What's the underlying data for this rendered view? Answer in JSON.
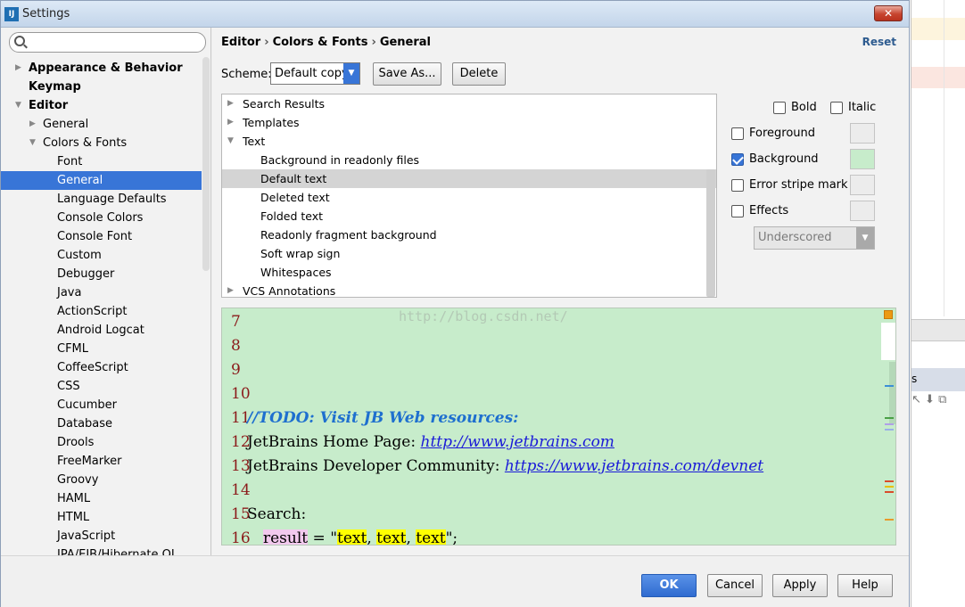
{
  "window": {
    "title": "Settings",
    "close_label": "✕"
  },
  "search": {
    "placeholder": "",
    "value": ""
  },
  "tree": [
    {
      "label": "Appearance & Behavior",
      "level": 0,
      "arrow": "▶",
      "bold": true,
      "selected": false
    },
    {
      "label": "Keymap",
      "level": 0,
      "arrow": "",
      "bold": true,
      "selected": false
    },
    {
      "label": "Editor",
      "level": 0,
      "arrow": "▼",
      "bold": true,
      "selected": false
    },
    {
      "label": "General",
      "level": 1,
      "arrow": "▶",
      "bold": false,
      "selected": false
    },
    {
      "label": "Colors & Fonts",
      "level": 1,
      "arrow": "▼",
      "bold": false,
      "selected": false
    },
    {
      "label": "Font",
      "level": 2,
      "arrow": "",
      "bold": false,
      "selected": false
    },
    {
      "label": "General",
      "level": 2,
      "arrow": "",
      "bold": false,
      "selected": true
    },
    {
      "label": "Language Defaults",
      "level": 2,
      "arrow": "",
      "bold": false,
      "selected": false
    },
    {
      "label": "Console Colors",
      "level": 2,
      "arrow": "",
      "bold": false,
      "selected": false
    },
    {
      "label": "Console Font",
      "level": 2,
      "arrow": "",
      "bold": false,
      "selected": false
    },
    {
      "label": "Custom",
      "level": 2,
      "arrow": "",
      "bold": false,
      "selected": false
    },
    {
      "label": "Debugger",
      "level": 2,
      "arrow": "",
      "bold": false,
      "selected": false
    },
    {
      "label": "Java",
      "level": 2,
      "arrow": "",
      "bold": false,
      "selected": false
    },
    {
      "label": "ActionScript",
      "level": 2,
      "arrow": "",
      "bold": false,
      "selected": false
    },
    {
      "label": "Android Logcat",
      "level": 2,
      "arrow": "",
      "bold": false,
      "selected": false
    },
    {
      "label": "CFML",
      "level": 2,
      "arrow": "",
      "bold": false,
      "selected": false
    },
    {
      "label": "CoffeeScript",
      "level": 2,
      "arrow": "",
      "bold": false,
      "selected": false
    },
    {
      "label": "CSS",
      "level": 2,
      "arrow": "",
      "bold": false,
      "selected": false
    },
    {
      "label": "Cucumber",
      "level": 2,
      "arrow": "",
      "bold": false,
      "selected": false
    },
    {
      "label": "Database",
      "level": 2,
      "arrow": "",
      "bold": false,
      "selected": false
    },
    {
      "label": "Drools",
      "level": 2,
      "arrow": "",
      "bold": false,
      "selected": false
    },
    {
      "label": "FreeMarker",
      "level": 2,
      "arrow": "",
      "bold": false,
      "selected": false
    },
    {
      "label": "Groovy",
      "level": 2,
      "arrow": "",
      "bold": false,
      "selected": false
    },
    {
      "label": "HAML",
      "level": 2,
      "arrow": "",
      "bold": false,
      "selected": false
    },
    {
      "label": "HTML",
      "level": 2,
      "arrow": "",
      "bold": false,
      "selected": false
    },
    {
      "label": "JavaScript",
      "level": 2,
      "arrow": "",
      "bold": false,
      "selected": false
    },
    {
      "label": "JPA/EJB/Hibernate QL",
      "level": 2,
      "arrow": "",
      "bold": false,
      "selected": false
    }
  ],
  "breadcrumb": {
    "part1": "Editor",
    "part2": "Colors & Fonts",
    "part3": "General",
    "sep": "›"
  },
  "reset_label": "Reset",
  "scheme": {
    "label": "Scheme:",
    "value": "Default copy",
    "save_as_label": "Save As...",
    "delete_label": "Delete"
  },
  "elements": [
    {
      "label": "Search Results",
      "arrow": "▶",
      "level": 0,
      "selected": false
    },
    {
      "label": "Templates",
      "arrow": "▶",
      "level": 0,
      "selected": false
    },
    {
      "label": "Text",
      "arrow": "▼",
      "level": 0,
      "selected": false
    },
    {
      "label": "Background in readonly files",
      "arrow": "",
      "level": 1,
      "selected": false
    },
    {
      "label": "Default text",
      "arrow": "",
      "level": 1,
      "selected": true
    },
    {
      "label": "Deleted text",
      "arrow": "",
      "level": 1,
      "selected": false
    },
    {
      "label": "Folded text",
      "arrow": "",
      "level": 1,
      "selected": false
    },
    {
      "label": "Readonly fragment background",
      "arrow": "",
      "level": 1,
      "selected": false
    },
    {
      "label": "Soft wrap sign",
      "arrow": "",
      "level": 1,
      "selected": false
    },
    {
      "label": "Whitespaces",
      "arrow": "",
      "level": 1,
      "selected": false
    },
    {
      "label": "VCS Annotations",
      "arrow": "▶",
      "level": 0,
      "selected": false
    }
  ],
  "attributes": {
    "bold_label": "Bold",
    "bold_checked": false,
    "italic_label": "Italic",
    "italic_checked": false,
    "foreground_label": "Foreground",
    "foreground_checked": false,
    "background_label": "Background",
    "background_checked": true,
    "background_color": "#c7eccb",
    "error_stripe_label": "Error stripe mark",
    "error_stripe_checked": false,
    "effects_label": "Effects",
    "effects_checked": false,
    "effect_type": "Underscored"
  },
  "preview": {
    "watermark": "http://blog.csdn.net/",
    "lines": [
      {
        "n": "7"
      },
      {
        "n": "8"
      },
      {
        "n": "9"
      },
      {
        "n": "10"
      },
      {
        "n": "11",
        "todo": "//TODO: Visit JB Web resources:"
      },
      {
        "n": "12",
        "pre": "JetBrains Home Page: ",
        "url": "http://www.jetbrains.com"
      },
      {
        "n": "13",
        "pre": "JetBrains Developer Community: ",
        "url": "https://www.jetbrains.com/devnet"
      },
      {
        "n": "14"
      },
      {
        "n": "15",
        "pre": "Search:"
      },
      {
        "n": "16",
        "result": "result",
        "eq": " = \"",
        "t1": "text",
        "c1": ", ",
        "t2": "text",
        "c2": ", ",
        "t3": "text",
        "end": "\";"
      }
    ]
  },
  "buttons": {
    "ok": "OK",
    "cancel": "Cancel",
    "apply": "Apply",
    "help": "Help"
  },
  "colors": {
    "accent": "#3875d7",
    "preview_bg": "#c7eccb",
    "todo": "#1e6fcf",
    "url": "#1a1ad8",
    "highlight": "#ffff00"
  },
  "bg_app": {
    "tab_text": "s"
  }
}
